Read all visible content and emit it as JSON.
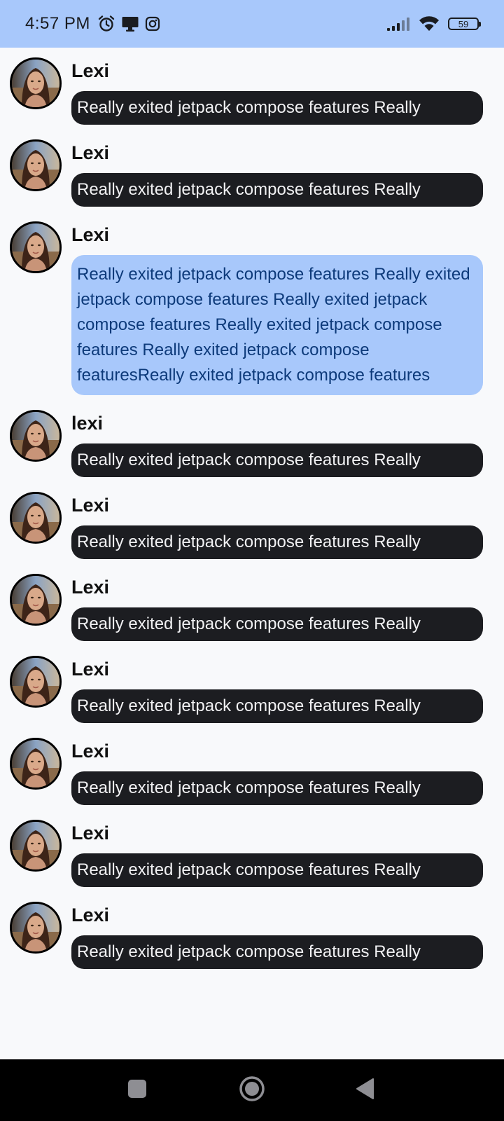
{
  "status_bar": {
    "time": "4:57 PM",
    "battery": "59",
    "icons": [
      "alarm-icon",
      "screen-cast-icon",
      "instagram-icon",
      "signal-icon",
      "wifi-icon",
      "battery-icon"
    ]
  },
  "colors": {
    "status_bar_bg": "#a8c8fb",
    "collapsed_bubble_bg": "#1c1d21",
    "collapsed_bubble_text": "#f1f1f3",
    "expanded_bubble_bg": "#a8c8fb",
    "expanded_bubble_text": "#0d3a7a",
    "nav_bar_bg": "#000000"
  },
  "messages": [
    {
      "author": "Lexi",
      "text": "Really exited jetpack compose features Really",
      "expanded": false
    },
    {
      "author": "Lexi",
      "text": "Really exited jetpack compose features Really",
      "expanded": false
    },
    {
      "author": "Lexi",
      "text": "Really exited jetpack compose features Really exited jetpack compose features Really exited jetpack compose features Really exited jetpack compose features Really exited jetpack compose featuresReally exited jetpack compose features",
      "expanded": true
    },
    {
      "author": "lexi",
      "text": "Really exited jetpack compose features Really",
      "expanded": false
    },
    {
      "author": "Lexi",
      "text": "Really exited jetpack compose features Really",
      "expanded": false
    },
    {
      "author": "Lexi",
      "text": "Really exited jetpack compose features Really",
      "expanded": false
    },
    {
      "author": "Lexi",
      "text": "Really exited jetpack compose features Really",
      "expanded": false
    },
    {
      "author": "Lexi",
      "text": "Really exited jetpack compose features Really",
      "expanded": false
    },
    {
      "author": "Lexi",
      "text": "Really exited jetpack compose features Really",
      "expanded": false
    },
    {
      "author": "Lexi",
      "text": "Really exited jetpack compose features Really",
      "expanded": false
    }
  ],
  "nav_bar": {
    "buttons": [
      "recents-icon",
      "home-icon",
      "back-icon"
    ]
  }
}
